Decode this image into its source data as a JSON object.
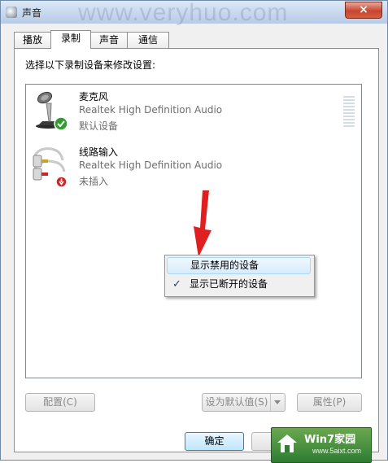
{
  "window": {
    "title": "声音",
    "watermark": "www.veryhuo.com",
    "close_glyph": "×"
  },
  "tabs": [
    {
      "label": "播放",
      "active": false
    },
    {
      "label": "录制",
      "active": true
    },
    {
      "label": "声音",
      "active": false
    },
    {
      "label": "通信",
      "active": false
    }
  ],
  "panel": {
    "instruction": "选择以下录制设备来修改设置:"
  },
  "devices": [
    {
      "name": "麦克风",
      "driver": "Realtek High Definition Audio",
      "status": "默认设备",
      "icon": "microphone-icon",
      "badge": "default-check-icon"
    },
    {
      "name": "线路输入",
      "driver": "Realtek High Definition Audio",
      "status": "未插入",
      "icon": "line-in-icon",
      "badge": "unplugged-icon"
    }
  ],
  "context_menu": {
    "items": [
      {
        "label": "显示禁用的设备",
        "checked": false,
        "highlighted": true
      },
      {
        "label": "显示已断开的设备",
        "checked": true,
        "highlighted": false
      }
    ],
    "check_glyph": "✓"
  },
  "buttons": {
    "configure": "配置(C)",
    "set_default": "设为默认值(S)",
    "properties": "属性(P)",
    "ok": "确定"
  },
  "logo": {
    "title": "Win7家园",
    "url": "www.5aixt.com"
  },
  "colors": {
    "accent_arrow": "#e02020",
    "default_badge": "#2e9e2e",
    "unplugged_badge": "#c62828",
    "menu_highlight": "#d5ecfb"
  }
}
